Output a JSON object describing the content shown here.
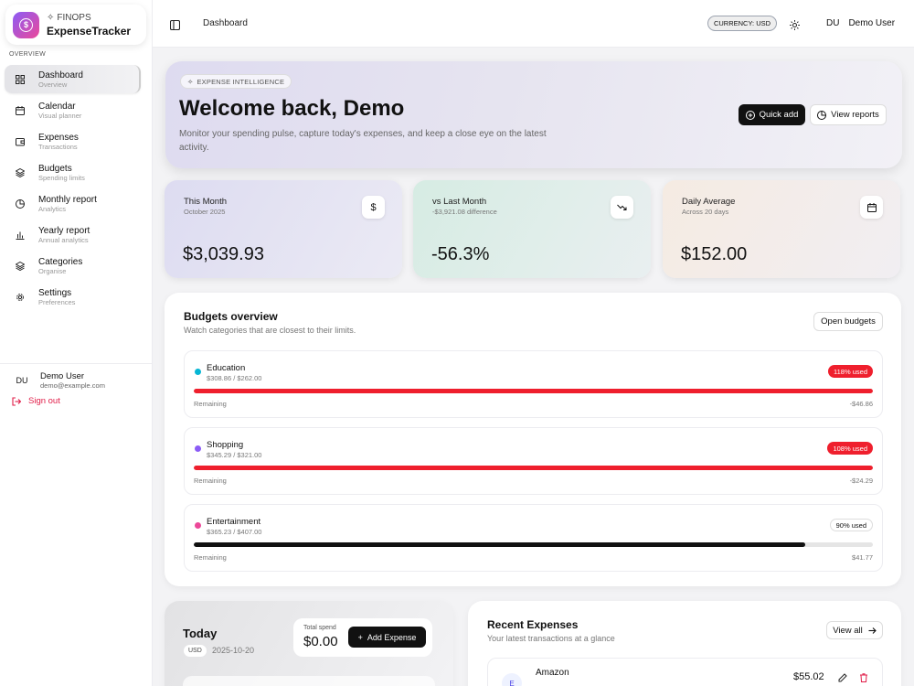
{
  "brand": {
    "eyebrow": "FINOPS",
    "name": "ExpenseTracker"
  },
  "nav": {
    "section_label": "OVERVIEW",
    "items": [
      {
        "label": "Dashboard",
        "sub": "Overview"
      },
      {
        "label": "Calendar",
        "sub": "Visual planner"
      },
      {
        "label": "Expenses",
        "sub": "Transactions"
      },
      {
        "label": "Budgets",
        "sub": "Spending limits"
      },
      {
        "label": "Monthly report",
        "sub": "Analytics"
      },
      {
        "label": "Yearly report",
        "sub": "Annual analytics"
      },
      {
        "label": "Categories",
        "sub": "Organise"
      },
      {
        "label": "Settings",
        "sub": "Preferences"
      }
    ]
  },
  "sidebar_user": {
    "initials": "DU",
    "name": "Demo User",
    "email": "demo@example.com",
    "signout": "Sign out"
  },
  "topbar": {
    "breadcrumb": "Dashboard",
    "currency": "CURRENCY: USD",
    "user_initials": "DU",
    "user_name": "Demo User"
  },
  "hero": {
    "chip": "EXPENSE INTELLIGENCE",
    "title": "Welcome back, Demo",
    "description": "Monitor your spending pulse, capture today's expenses, and keep a close eye on the latest activity.",
    "quick_add": "Quick add",
    "view_reports": "View reports"
  },
  "stats": [
    {
      "label": "This Month",
      "sub": "October 2025",
      "value": "$3,039.93",
      "icon": "dollar-icon"
    },
    {
      "label": "vs Last Month",
      "sub": "-$3,921.08 difference",
      "value": "-56.3%",
      "icon": "trending-down-icon"
    },
    {
      "label": "Daily Average",
      "sub": "Across 20 days",
      "value": "$152.00",
      "icon": "calendar-icon"
    }
  ],
  "budgets": {
    "title": "Budgets overview",
    "subtitle": "Watch categories that are closest to their limits.",
    "open_button": "Open budgets",
    "remaining_label": "Remaining",
    "items": [
      {
        "name": "Education",
        "amount": "$308.86 / $262.00",
        "badge": "118% used",
        "remaining": "-$46.86",
        "percent": 118,
        "dot_color": "#06b6d4",
        "bar_color": "#ef1f2d",
        "over": true
      },
      {
        "name": "Shopping",
        "amount": "$345.29 / $321.00",
        "badge": "108% used",
        "remaining": "-$24.29",
        "percent": 108,
        "dot_color": "#8b5cf6",
        "bar_color": "#ef1f2d",
        "over": true
      },
      {
        "name": "Entertainment",
        "amount": "$365.23 / $407.00",
        "badge": "90% used",
        "remaining": "$41.77",
        "percent": 90,
        "dot_color": "#ec4899",
        "bar_color": "#111111",
        "over": false
      }
    ]
  },
  "today": {
    "title": "Today",
    "currency": "USD",
    "date": "2025-10-20",
    "spend_label": "Total spend",
    "spend_value": "$0.00",
    "add_button": "Add Expense"
  },
  "recent": {
    "title": "Recent Expenses",
    "subtitle": "Your latest transactions at a glance",
    "view_all": "View all",
    "items": [
      {
        "initial": "E",
        "name": "Amazon",
        "amount": "$55.02"
      }
    ]
  }
}
